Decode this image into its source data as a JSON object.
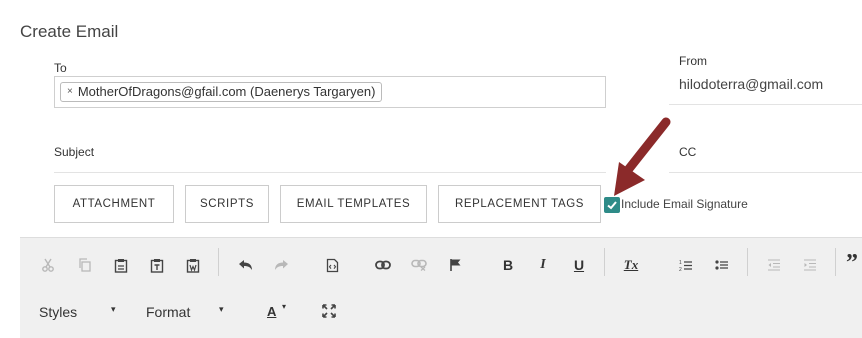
{
  "header": {
    "title": "Create Email"
  },
  "to": {
    "label": "To",
    "recipients": [
      {
        "remove_icon": "×",
        "text": "MotherOfDragons@gfail.com (Daenerys Targaryen)"
      }
    ]
  },
  "from": {
    "label": "From",
    "value": "hilodoterra@gmail.com"
  },
  "subject": {
    "label": "Subject",
    "value": ""
  },
  "cc": {
    "label": "CC",
    "value": ""
  },
  "buttons": {
    "attachment": "ATTACHMENT",
    "scripts": "SCRIPTS",
    "email_templates": "EMAIL TEMPLATES",
    "replacement_tags": "REPLACEMENT TAGS"
  },
  "signature": {
    "label": "Include Email Signature",
    "checked": true
  },
  "editor": {
    "toolbar_icons": [
      "cut-icon",
      "copy-icon",
      "paste-icon",
      "paste-text-icon",
      "paste-word-icon",
      "undo-icon",
      "redo-icon",
      "source-icon",
      "link-icon",
      "unlink-icon",
      "anchor-flag-icon",
      "bold-icon",
      "italic-icon",
      "underline-icon",
      "remove-format-icon",
      "numbered-list-icon",
      "bulleted-list-icon",
      "decrease-indent-icon",
      "increase-indent-icon",
      "blockquote-icon",
      "text-color-icon",
      "maximize-icon"
    ],
    "bold": "B",
    "italic": "I",
    "underline": "U",
    "remove_format": "Tx",
    "blockquote": "”",
    "styles_label": "Styles",
    "format_label": "Format",
    "text_color": "A",
    "caret": "▾"
  },
  "colors": {
    "checkbox": "#2e8b88",
    "arrow": "#8b2a2a",
    "toolbar_bg": "#f0f0f0"
  }
}
